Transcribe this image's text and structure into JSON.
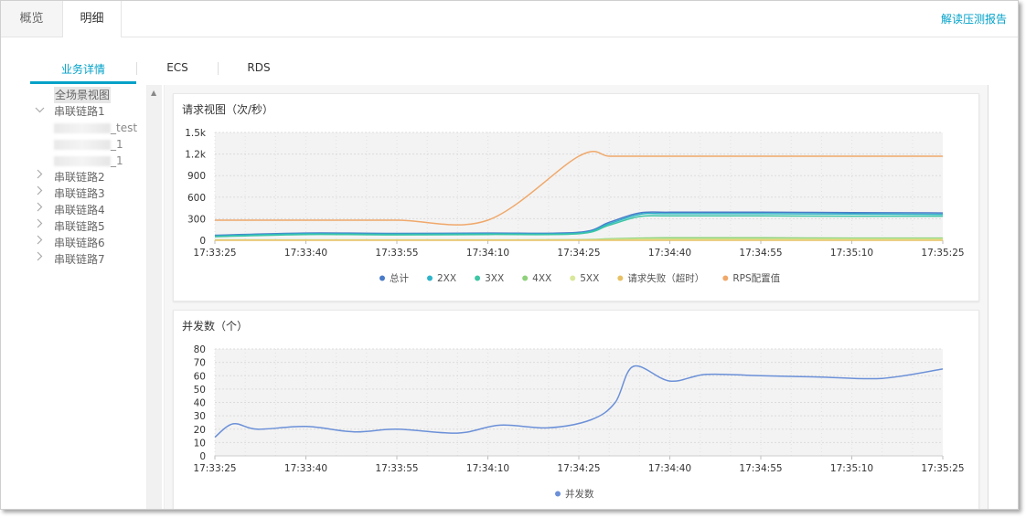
{
  "tabs": {
    "overview": "概览",
    "detail": "明细"
  },
  "report_link": "解读压测报告",
  "sub_tabs": [
    "业务详情",
    "ECS",
    "RDS"
  ],
  "tree": {
    "root": "全场景视图",
    "chain1": "串联链路1",
    "chain1_children": [
      "_test",
      "_1",
      "_1"
    ],
    "chains": [
      "串联链路2",
      "串联链路3",
      "串联链路4",
      "串联链路5",
      "串联链路6",
      "串联链路7"
    ]
  },
  "x_ticks": [
    "17:33:25",
    "17:33:40",
    "17:33:55",
    "17:34:10",
    "17:34:25",
    "17:34:40",
    "17:34:55",
    "17:35:10",
    "17:35:25"
  ],
  "colors": {
    "accent": "#00a1c8",
    "total": "#4a7bc8",
    "s2xx": "#2fb3c9",
    "s3xx": "#3ec6a5",
    "s4xx": "#8fd17a",
    "s5xx": "#d8e89a",
    "timeout": "#e8c165",
    "rps": "#f0a86a",
    "concurrency": "#6b90d8"
  },
  "chart_data": [
    {
      "type": "line",
      "title": "请求视图（次/秒）",
      "x": [
        "17:33:25",
        "17:33:40",
        "17:33:55",
        "17:34:10",
        "17:34:25",
        "17:34:30",
        "17:34:35",
        "17:34:40",
        "17:34:55",
        "17:35:10",
        "17:35:25"
      ],
      "y_ticks": [
        "0",
        "300",
        "600",
        "900",
        "1.2k",
        "1.5k"
      ],
      "ylim": [
        0,
        1500
      ],
      "series": [
        {
          "name": "总计",
          "values": [
            70,
            100,
            95,
            100,
            110,
            250,
            380,
            390,
            390,
            385,
            380
          ]
        },
        {
          "name": "2XX",
          "values": [
            60,
            90,
            85,
            90,
            100,
            230,
            360,
            370,
            370,
            365,
            360
          ]
        },
        {
          "name": "3XX",
          "values": [
            50,
            80,
            75,
            80,
            90,
            210,
            330,
            340,
            340,
            335,
            335
          ]
        },
        {
          "name": "4XX",
          "values": [
            5,
            5,
            5,
            5,
            8,
            20,
            30,
            35,
            35,
            30,
            30
          ]
        },
        {
          "name": "5XX",
          "values": [
            3,
            3,
            3,
            3,
            5,
            10,
            15,
            15,
            15,
            15,
            15
          ]
        },
        {
          "name": "请求失败（超时）",
          "values": [
            0,
            0,
            0,
            0,
            0,
            0,
            0,
            0,
            0,
            0,
            0
          ]
        },
        {
          "name": "RPS配置值",
          "values": [
            280,
            280,
            280,
            280,
            1170,
            1170,
            1170,
            1170,
            1170,
            1170,
            1170
          ]
        }
      ]
    },
    {
      "type": "line",
      "title": "并发数（个）",
      "x": [
        "17:33:25",
        "17:33:28",
        "17:33:32",
        "17:33:40",
        "17:33:48",
        "17:33:55",
        "17:34:05",
        "17:34:12",
        "17:34:20",
        "17:34:27",
        "17:34:31",
        "17:34:34",
        "17:34:40",
        "17:34:46",
        "17:34:55",
        "17:35:05",
        "17:35:15",
        "17:35:25"
      ],
      "y_ticks": [
        "0",
        "10",
        "20",
        "30",
        "40",
        "50",
        "60",
        "70",
        "80"
      ],
      "ylim": [
        0,
        80
      ],
      "series": [
        {
          "name": "并发数",
          "values": [
            14,
            24,
            20,
            22,
            18,
            20,
            17,
            23,
            21,
            27,
            40,
            67,
            56,
            61,
            60,
            59,
            58,
            65
          ]
        }
      ]
    }
  ]
}
